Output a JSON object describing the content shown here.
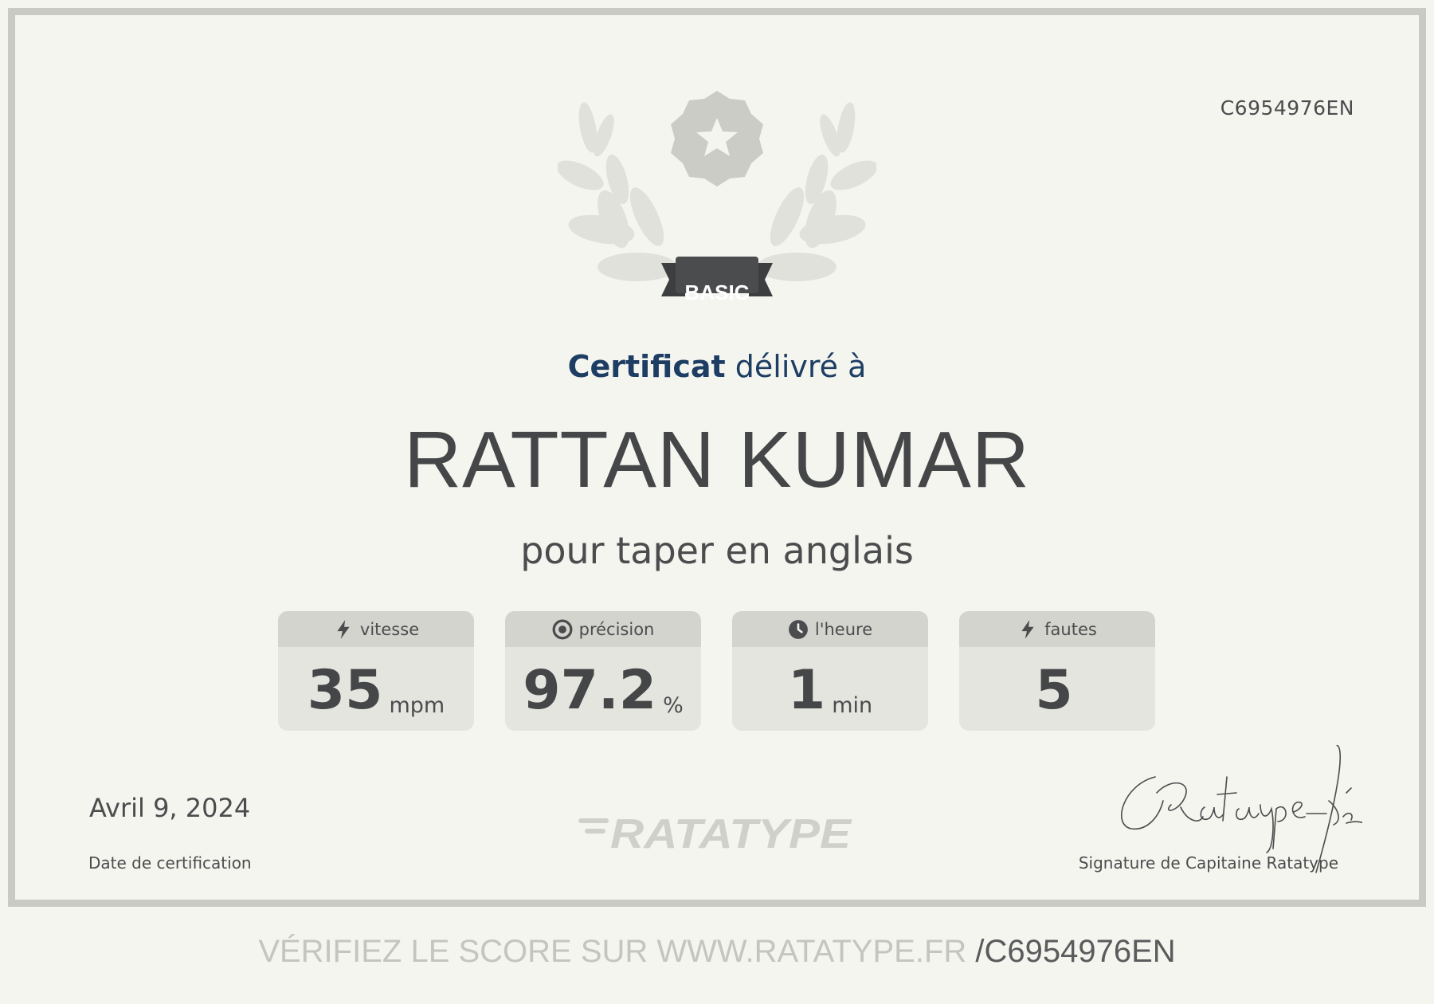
{
  "certificate_id": "C6954976EN",
  "badge": {
    "label": "BASIC"
  },
  "heading": {
    "strong": "Certificat",
    "light": "délivré à"
  },
  "recipient": "RATTAN KUMAR",
  "purpose": "pour taper en anglais",
  "stats": [
    {
      "label": "vitesse",
      "icon": "lightning-icon",
      "value": "35",
      "unit": "mpm"
    },
    {
      "label": "précision",
      "icon": "target-icon",
      "value": "97.2",
      "unit": "%"
    },
    {
      "label": "l'heure",
      "icon": "clock-icon",
      "value": "1",
      "unit": "min"
    },
    {
      "label": "fautes",
      "icon": "lightning-icon",
      "value": "5",
      "unit": ""
    }
  ],
  "date": {
    "value": "Avril 9, 2024",
    "label": "Date de certification"
  },
  "logo_text": "RATATYPE",
  "signature": {
    "text": "CRatatype-fé",
    "label": "Signature de Capitaine Ratatype"
  },
  "verify": {
    "prefix": "VÉRIFIEZ LE SCORE SUR WWW.RATATYPE.FR",
    "code": "/C6954976EN"
  },
  "colors": {
    "background": "#f4f5ef",
    "frame": "#c9cac4",
    "heading_blue": "#1d3d63",
    "text_dark": "#4b4c4d",
    "stat_box": "#e4e5df",
    "stat_header": "#d3d4ce"
  }
}
